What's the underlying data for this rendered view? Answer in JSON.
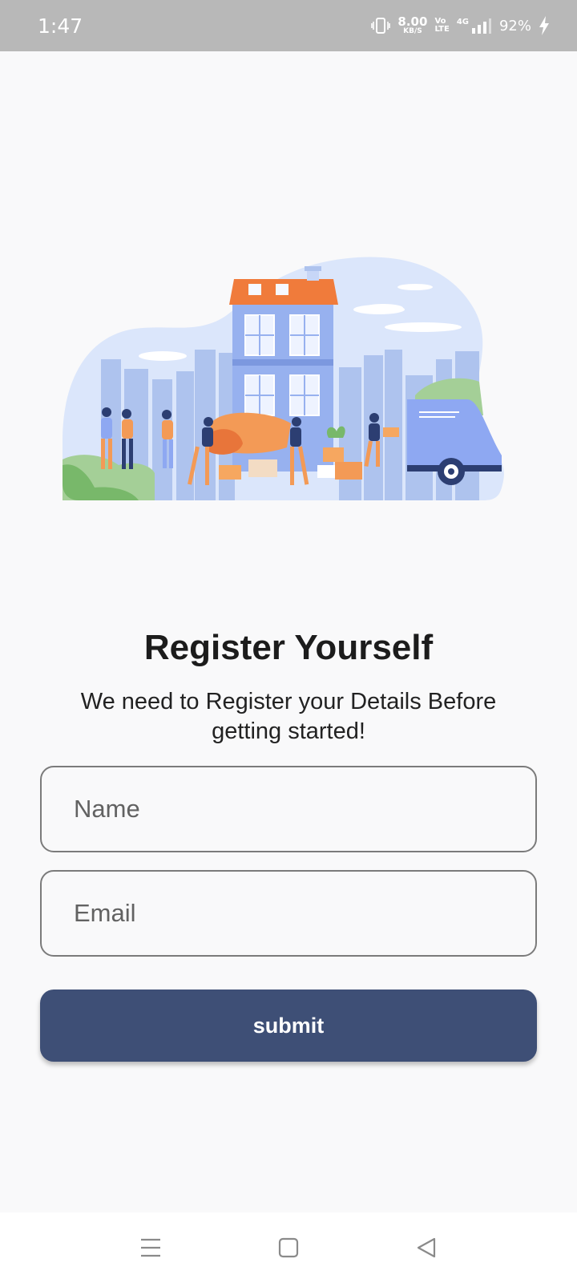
{
  "status_bar": {
    "time": "1:47",
    "network_speed_value": "8.00",
    "network_speed_unit": "KB/S",
    "volte_top": "Vo",
    "volte_bottom": "LTE",
    "network_type": "4G",
    "battery": "92%"
  },
  "hero": {
    "image": "moving-house-illustration"
  },
  "header": {
    "title": "Register Yourself",
    "subtitle": "We need to Register your Details Before getting started!"
  },
  "form": {
    "name_placeholder": "Name",
    "email_placeholder": "Email",
    "submit_label": "submit"
  },
  "colors": {
    "accent": "#3e4f76",
    "status_bar": "#b8b8b8",
    "background": "#f9f9fa"
  },
  "nav": {
    "icons": [
      "menu-icon",
      "home-icon",
      "back-icon"
    ]
  }
}
